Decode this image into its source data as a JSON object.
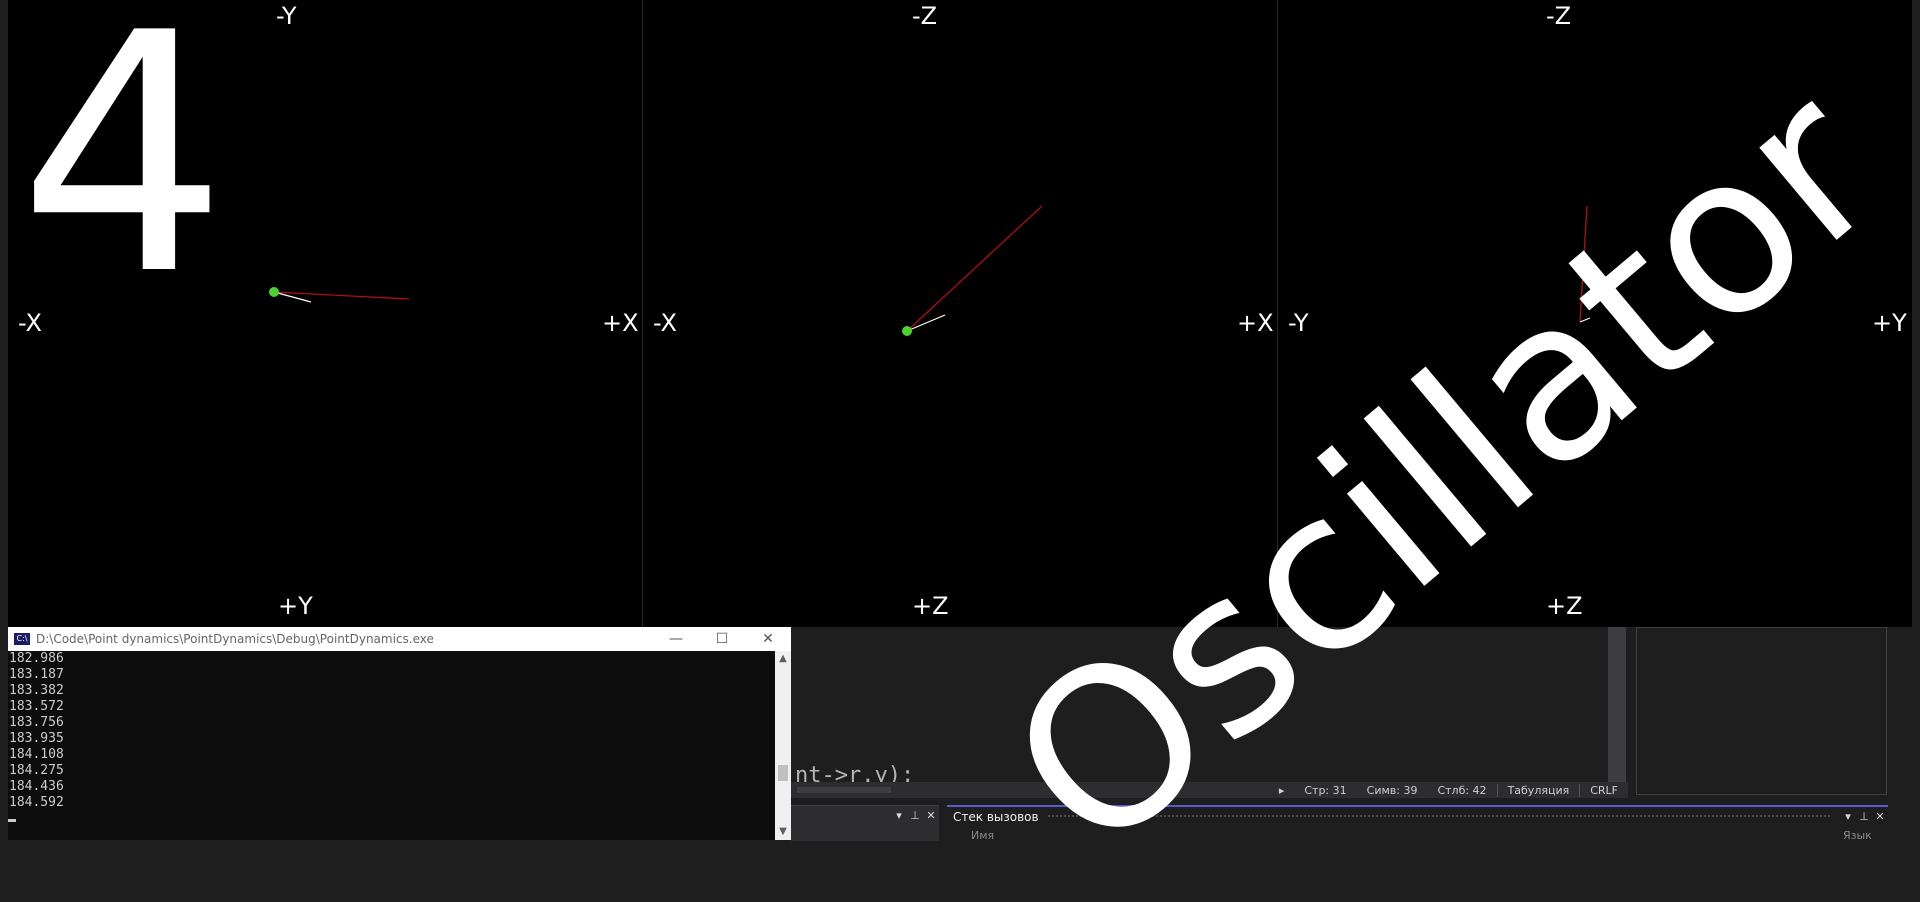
{
  "viewports": [
    {
      "id": "xy",
      "labels": {
        "top": "-Y",
        "bottom": "+Y",
        "left": "-X",
        "right": "+X"
      }
    },
    {
      "id": "xz",
      "labels": {
        "top": "-Z",
        "bottom": "+Z",
        "left": "-X",
        "right": "+X"
      }
    },
    {
      "id": "yz",
      "labels": {
        "top": "-Z",
        "bottom": "+Z",
        "left": "-Y",
        "right": "+Y"
      }
    }
  ],
  "overlay": {
    "number": "4",
    "title": "Oscillator"
  },
  "console": {
    "title": "D:\\Code\\Point dynamics\\PointDynamics\\Debug\\PointDynamics.exe",
    "icon": "C:\\",
    "lines": [
      "182.986",
      "183.187",
      "183.382",
      "183.572",
      "183.756",
      "183.935",
      "184.108",
      "184.275",
      "184.436",
      "184.592"
    ]
  },
  "editor": {
    "code_fragment": "nt->r.y);"
  },
  "status_bar": {
    "line": "Стр: 31",
    "char": "Симв: 39",
    "col": "Стлб: 42",
    "indent": "Табуляция",
    "eol": "CRLF"
  },
  "call_stack_panel": {
    "title": "Стек вызовов",
    "col_name": "Имя",
    "col_lang": "Язык"
  },
  "colors": {
    "point": "#4cd130",
    "velocity": "#ffffff",
    "force": "#b01010"
  }
}
